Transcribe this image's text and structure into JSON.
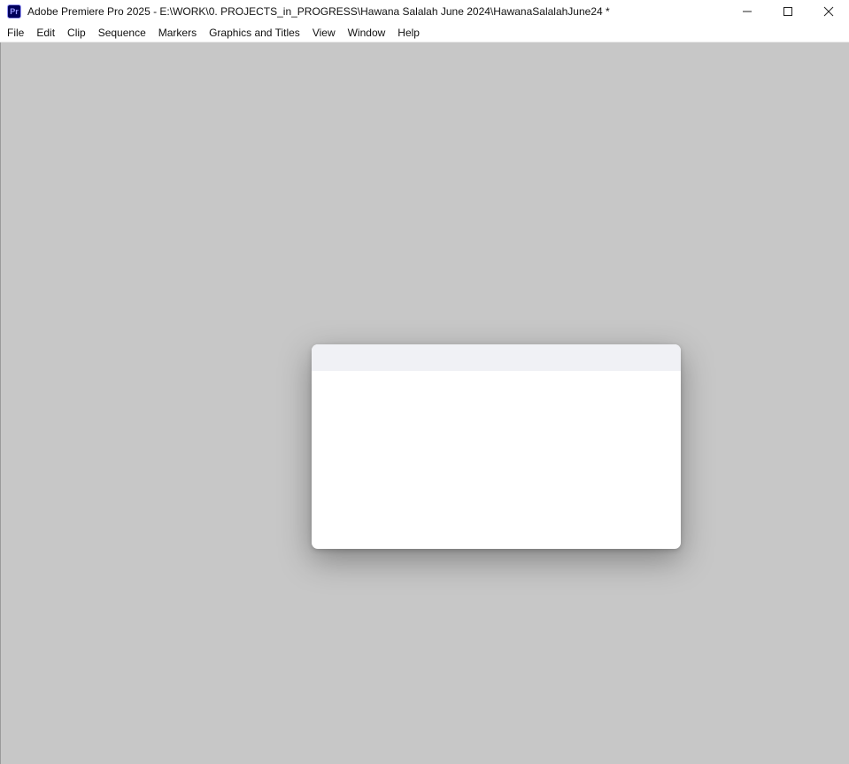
{
  "app": {
    "icon_label": "Pr",
    "title": "Adobe Premiere Pro 2025 - E:\\WORK\\0. PROJECTS_in_PROGRESS\\Hawana Salalah June 2024\\HawanaSalalahJune24 *"
  },
  "window_controls": {
    "minimize": "minimize-icon",
    "maximize": "maximize-icon",
    "close": "close-icon"
  },
  "menubar": {
    "items": [
      {
        "label": "File"
      },
      {
        "label": "Edit"
      },
      {
        "label": "Clip"
      },
      {
        "label": "Sequence"
      },
      {
        "label": "Markers"
      },
      {
        "label": "Graphics and Titles"
      },
      {
        "label": "View"
      },
      {
        "label": "Window"
      },
      {
        "label": "Help"
      }
    ]
  },
  "colors": {
    "workspace": "#c7c7c7",
    "dialog_header": "#f0f1f5",
    "dialog_body": "#ffffff",
    "app_icon": "#00005b"
  }
}
